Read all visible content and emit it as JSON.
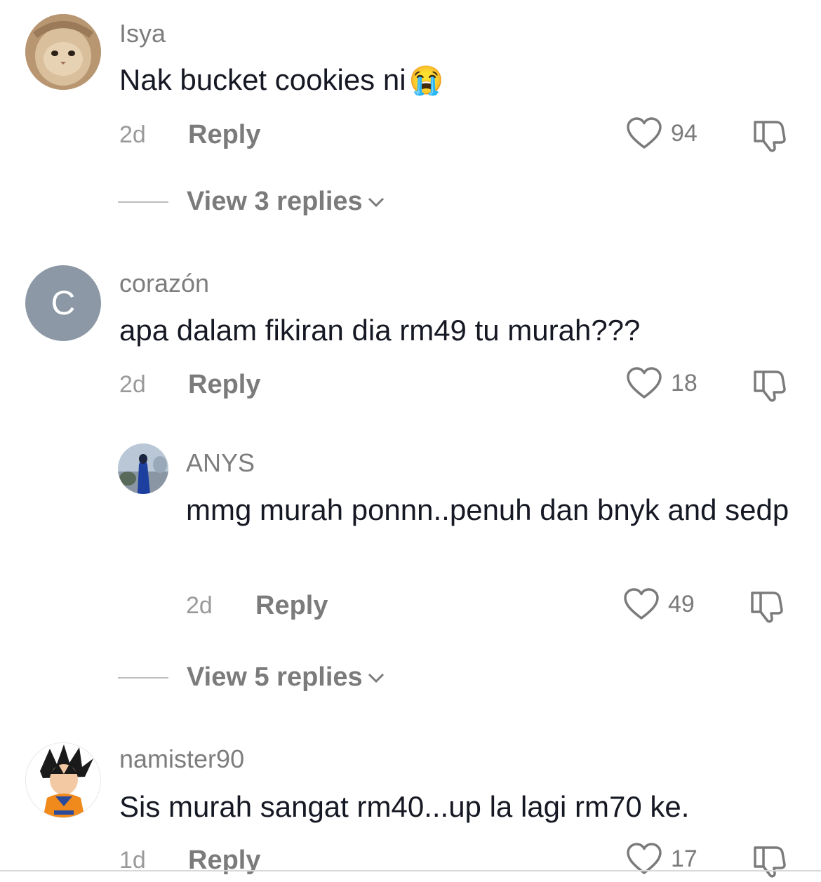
{
  "comments": [
    {
      "username": "Isya",
      "text": "Nak bucket cookies ni",
      "emoji": "😭",
      "time": "2d",
      "reply_label": "Reply",
      "likes": "94",
      "view_replies": "View 3 replies"
    },
    {
      "username": "corazón",
      "avatar_letter": "C",
      "text": "apa dalam fikiran dia rm49 tu murah???",
      "time": "2d",
      "reply_label": "Reply",
      "likes": "18",
      "view_replies": "View 5 replies"
    },
    {
      "username": "namister90",
      "text": "Sis murah sangat rm40...up la lagi rm70 ke.",
      "time": "1d",
      "reply_label": "Reply",
      "likes": "17"
    }
  ],
  "reply": {
    "username": "ANYS",
    "text": "mmg murah ponnn..penuh dan bnyk and sedp",
    "time": "2d",
    "reply_label": "Reply",
    "likes": "49"
  },
  "colors": {
    "avatar_letter_bg": "#8c98a6",
    "text": "#161823",
    "muted": "#7b7b7b"
  }
}
